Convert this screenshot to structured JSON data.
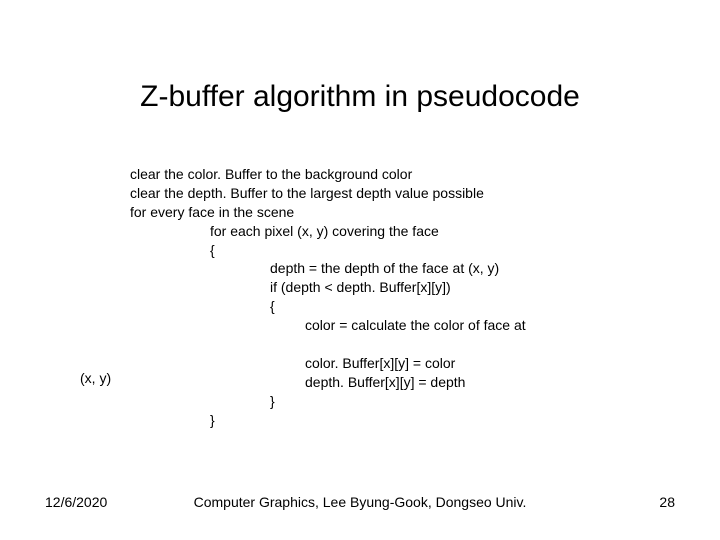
{
  "title": "Z-buffer algorithm in pseudocode",
  "pseudocode": {
    "l1": "clear the color. Buffer to the background color",
    "l2": "clear the depth. Buffer to the largest depth value possible",
    "l3": "for every face in the scene",
    "l4": "for each pixel (x, y) covering the face",
    "l5": "{",
    "l6": "depth = the depth of the face at (x, y)",
    "l7": "if (depth < depth. Buffer[x][y])",
    "l8": "{",
    "l9": "color = calculate the color of face at",
    "l10": "color. Buffer[x][y] = color",
    "l11": "depth. Buffer[x][y] = depth",
    "l12": "}",
    "l13": "}",
    "xy": "(x, y)"
  },
  "footer": {
    "date": "12/6/2020",
    "center": "Computer Graphics, Lee Byung-Gook, Dongseo Univ.",
    "page": "28"
  }
}
